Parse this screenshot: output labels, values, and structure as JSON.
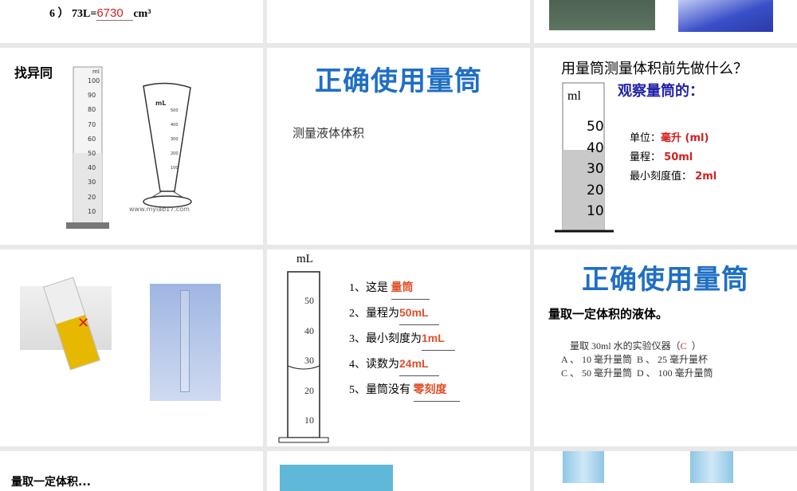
{
  "slides": [
    {
      "id": "s1",
      "q_label": "6 ） 73L=",
      "answer": "6730",
      "unit": "cm³"
    },
    {
      "id": "s3"
    },
    {
      "id": "s4",
      "title": "找异同",
      "cyl_unit": "ml",
      "cyl_ticks": [
        "100",
        "90",
        "80",
        "70",
        "60",
        "50",
        "40",
        "30",
        "20",
        "10"
      ],
      "beaker_unit": "mL",
      "beaker_ticks": [
        "500",
        "400",
        "300",
        "200",
        "100"
      ],
      "watermark": "www.mylab17.com"
    },
    {
      "id": "s5",
      "title": "正确使用量筒",
      "body": "测量液体体积"
    },
    {
      "id": "s6",
      "title": "用量筒测量体积前先做什么？",
      "subtitle": "观察量筒的：",
      "cyl_unit": "ml",
      "cyl_ticks": [
        "50",
        "40",
        "30",
        "20",
        "10"
      ],
      "unit_label": "单位：",
      "unit_value": "毫升 (ml)",
      "range_label": "量程：",
      "range_value": "50ml",
      "min_label": "最小刻度值：",
      "min_value": "2ml"
    },
    {
      "id": "s7",
      "wrong_mark": "✕"
    },
    {
      "id": "s8",
      "cyl_unit": "mL",
      "cyl_ticks": [
        "50",
        "40",
        "30",
        "20",
        "10"
      ],
      "items": [
        {
          "label": "1、这是",
          "answer": "量筒"
        },
        {
          "label": "2、量程为",
          "answer": "50mL"
        },
        {
          "label": "3、最小刻度为",
          "answer": "1mL"
        },
        {
          "label": "4、读数为",
          "answer": "24mL"
        },
        {
          "label": "5、量筒没有",
          "answer": "零刻度"
        }
      ]
    },
    {
      "id": "s9",
      "title": "正确使用量筒",
      "body": "量取一定体积的液体。",
      "question": "量取 30ml 水的实验仪器（",
      "answer": "C",
      "question_end": "）",
      "options": [
        "A 、 10 毫升量筒  B 、 25 毫升量杯",
        "C 、 50 毫升量筒  D 、 100 毫升量筒"
      ]
    },
    {
      "id": "s10",
      "partial_text": "量取一定体积..."
    }
  ]
}
